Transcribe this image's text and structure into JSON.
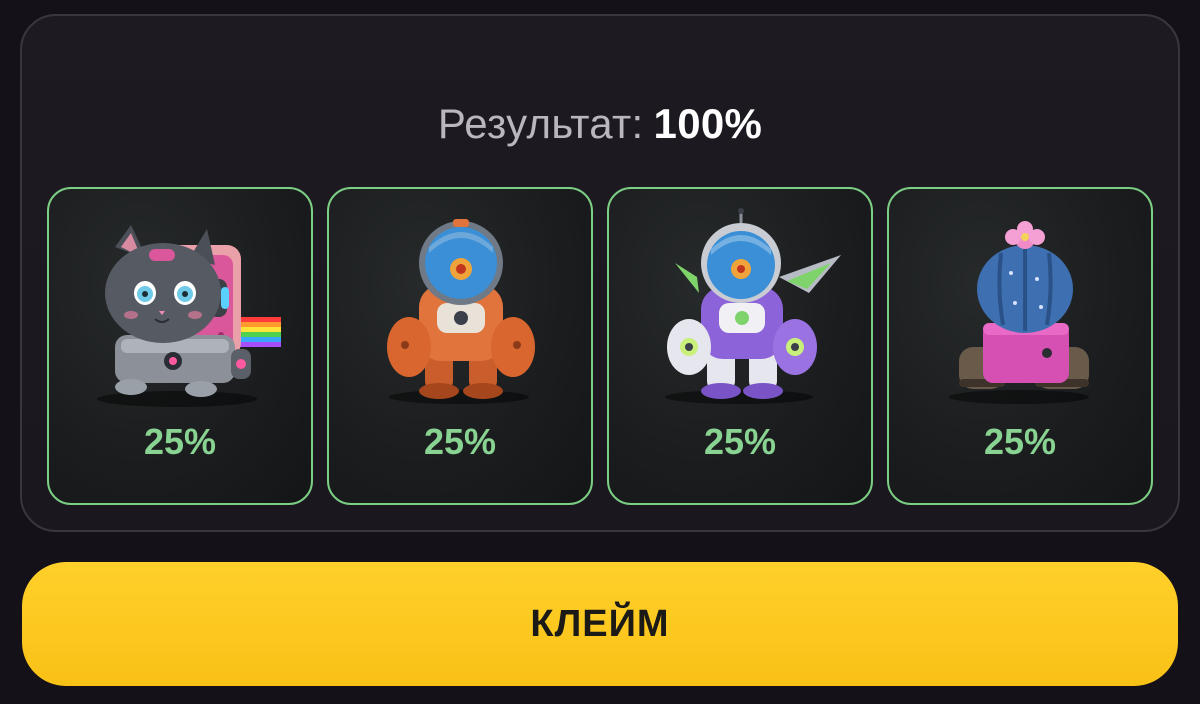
{
  "result": {
    "label": "Результат:",
    "value": "100%"
  },
  "cards": [
    {
      "name": "robot-cat",
      "percent": "25%"
    },
    {
      "name": "orange-diver-robot",
      "percent": "25%"
    },
    {
      "name": "purple-astronaut-robot",
      "percent": "25%"
    },
    {
      "name": "cactus-tank",
      "percent": "25%"
    }
  ],
  "claim_button": {
    "label": "КЛЕЙМ"
  },
  "colors": {
    "accent_green": "#7ccd85",
    "button_yellow": "#fcc71d",
    "background": "#141118"
  }
}
